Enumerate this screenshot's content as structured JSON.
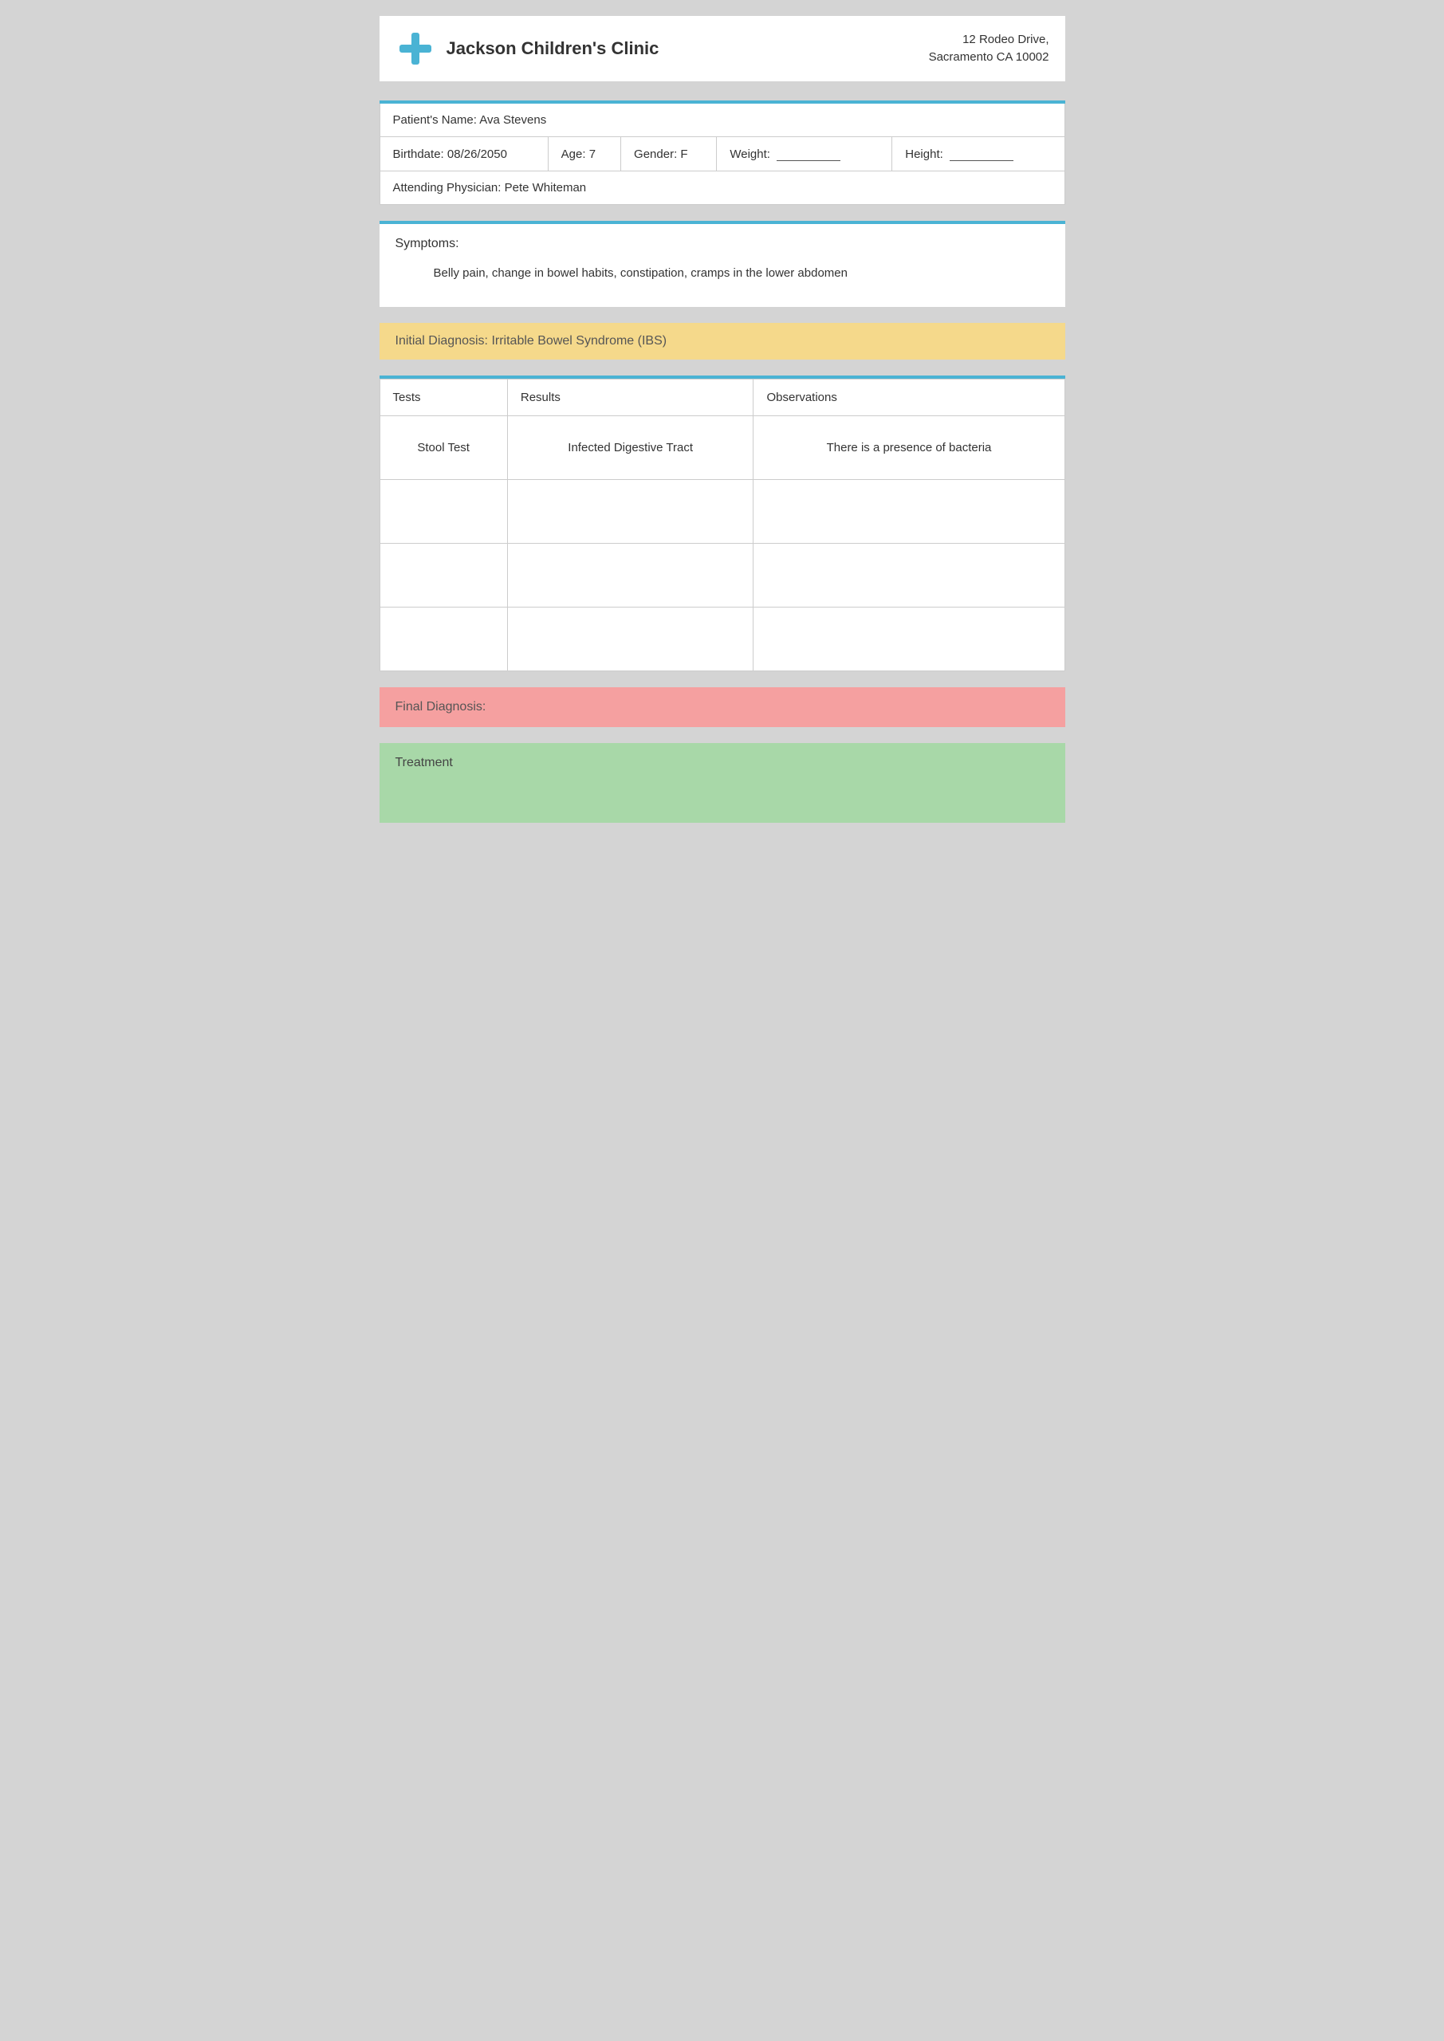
{
  "header": {
    "clinic_name": "Jackson Children's Clinic",
    "address_line1": "12 Rodeo Drive,",
    "address_line2": "Sacramento CA 10002"
  },
  "patient": {
    "name_label": "Patient's Name:",
    "name_value": "Ava Stevens",
    "birthdate_label": "Birthdate:",
    "birthdate_value": "08/26/2050",
    "age_label": "Age:",
    "age_value": "7",
    "gender_label": "Gender:",
    "gender_value": "F",
    "weight_label": "Weight:",
    "height_label": "Height:",
    "physician_label": "Attending Physician:",
    "physician_value": "Pete Whiteman"
  },
  "symptoms": {
    "label": "Symptoms:",
    "text": "Belly pain, change in bowel habits, constipation, cramps in the lower abdomen"
  },
  "initial_diagnosis": {
    "label": "Initial Diagnosis: Irritable Bowel Syndrome (IBS)"
  },
  "tests_table": {
    "col_tests": "Tests",
    "col_results": "Results",
    "col_observations": "Observations",
    "rows": [
      {
        "test": "Stool Test",
        "result": "Infected Digestive Tract",
        "observation": "There is a presence of bacteria"
      },
      {
        "test": "",
        "result": "",
        "observation": ""
      },
      {
        "test": "",
        "result": "",
        "observation": ""
      },
      {
        "test": "",
        "result": "",
        "observation": ""
      }
    ]
  },
  "final_diagnosis": {
    "label": "Final Diagnosis:"
  },
  "treatment": {
    "label": "Treatment"
  }
}
